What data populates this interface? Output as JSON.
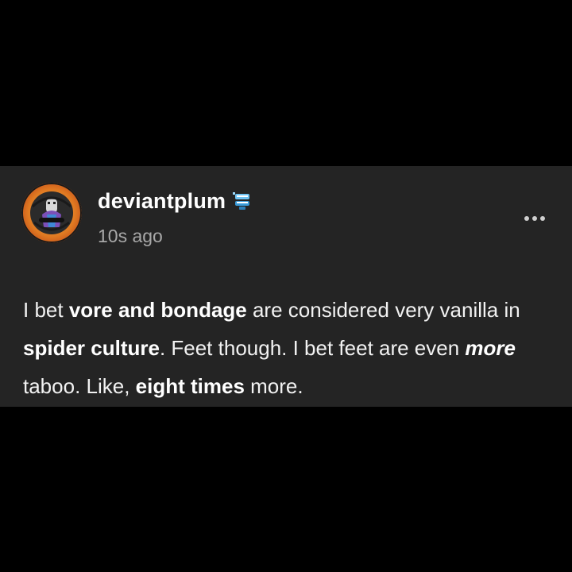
{
  "post": {
    "username": "deviantplum",
    "timestamp": "10s ago",
    "badge_icon": "toy-chatter-teeth-icon",
    "avatar_icon": "blog-avatar-icon",
    "more_icon": "ellipsis-icon",
    "body": [
      {
        "text": "I bet ",
        "style": "normal"
      },
      {
        "text": "vore and bondage",
        "style": "bold"
      },
      {
        "text": " are considered very vanilla in ",
        "style": "normal"
      },
      {
        "text": "spider culture",
        "style": "bold"
      },
      {
        "text": ". Feet though. I bet feet are even ",
        "style": "normal"
      },
      {
        "text": "more",
        "style": "bold-italic"
      },
      {
        "text": " taboo. Like, ",
        "style": "normal"
      },
      {
        "text": "eight times",
        "style": "bold"
      },
      {
        "text": " more.",
        "style": "normal"
      }
    ]
  },
  "colors": {
    "page_background": "#000000",
    "card_background": "#242424",
    "text_primary": "#ffffff",
    "text_secondary": "#a8a8a8",
    "avatar_orange": "#e07a22",
    "badge_blue": "#3a9bd9"
  }
}
